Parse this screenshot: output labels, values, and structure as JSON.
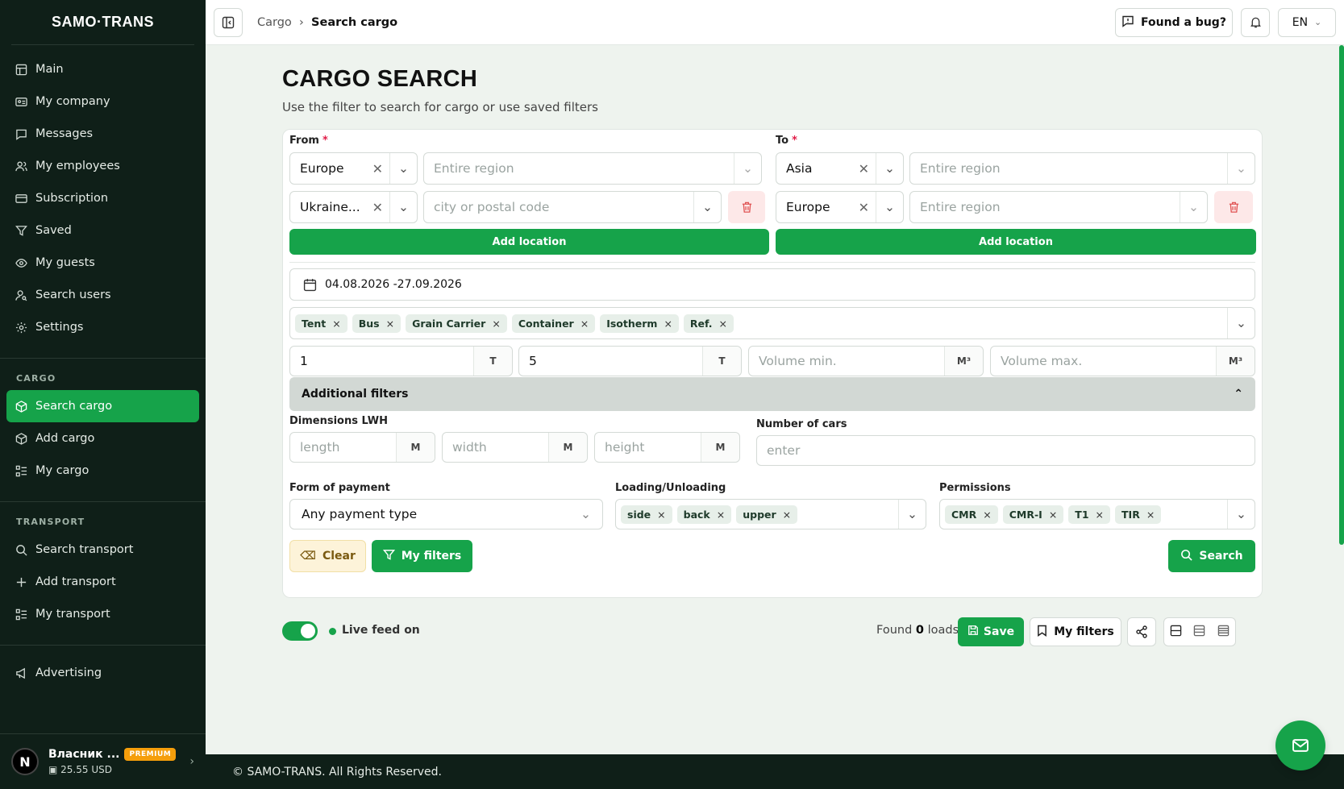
{
  "brand": "SAMO·TRANS",
  "sidebar": {
    "items": [
      {
        "label": "Main",
        "icon": "table-icon"
      },
      {
        "label": "My company",
        "icon": "id-card-icon"
      },
      {
        "label": "Messages",
        "icon": "message-icon"
      },
      {
        "label": "My employees",
        "icon": "users-icon"
      },
      {
        "label": "Subscription",
        "icon": "card-icon"
      },
      {
        "label": "Saved",
        "icon": "filter-icon"
      },
      {
        "label": "My guests",
        "icon": "eye-icon"
      },
      {
        "label": "Search users",
        "icon": "user-search-icon"
      },
      {
        "label": "Settings",
        "icon": "gear-icon"
      }
    ],
    "cargo_title": "CARGO",
    "cargo_items": [
      {
        "label": "Search cargo"
      },
      {
        "label": "Add cargo"
      },
      {
        "label": "My cargo"
      }
    ],
    "transport_title": "TRANSPORT",
    "transport_items": [
      {
        "label": "Search transport"
      },
      {
        "label": "Add transport"
      },
      {
        "label": "My transport"
      }
    ],
    "advertising": "Advertising",
    "user": {
      "initial": "N",
      "name": "Власник ...",
      "badge": "PREMIUM",
      "balance": "25.55 USD"
    }
  },
  "topbar": {
    "crumb_parent": "Cargo",
    "crumb_sep": "›",
    "crumb_current": "Search cargo",
    "bug": "Found a bug?",
    "lang": "EN"
  },
  "page": {
    "title": "CARGO SEARCH",
    "subtitle": "Use the filter to search for cargo or use saved filters"
  },
  "form": {
    "from_label": "From",
    "to_label": "To",
    "req": "*",
    "from1": "Europe",
    "from1_region": "Entire region",
    "from2": "Ukraine...",
    "from2_city": "city or postal code",
    "to1": "Asia",
    "to1_region": "Entire region",
    "to2": "Europe",
    "to2_region": "Entire region",
    "add_location": "Add location",
    "date_range": "04.08.2026 -27.09.2026",
    "body_types": [
      "Tent",
      "Bus",
      "Grain Carrier",
      "Container",
      "Isotherm",
      "Ref."
    ],
    "weight_min": "1",
    "weight_max": "5",
    "weight_unit": "T",
    "volume_min": "Volume min.",
    "volume_max": "Volume max.",
    "volume_unit": "M³",
    "additional": "Additional filters",
    "dims_label": "Dimensions LWH",
    "length": "length",
    "width": "width",
    "height": "height",
    "dim_unit": "M",
    "cars_label": "Number of cars",
    "cars_ph": "enter",
    "payment_label": "Form of payment",
    "payment_value": "Any payment type",
    "loading_label": "Loading/Unloading",
    "loading_tags": [
      "side",
      "back",
      "upper"
    ],
    "perm_label": "Permissions",
    "perm_tags": [
      "CMR",
      "CMR-I",
      "T1",
      "TIR"
    ],
    "clear": "Clear",
    "my_filters": "My filters",
    "search": "Search"
  },
  "results": {
    "live_feed": "Live feed on",
    "found_prefix": "Found",
    "found_count": "0",
    "found_suffix": "loads",
    "save": "Save",
    "my_filters": "My filters"
  },
  "footer": "© SAMO-TRANS. All Rights Reserved.",
  "colors": {
    "accent": "#16a34a",
    "sidebar": "#0f1f18",
    "danger": "#e05252"
  }
}
